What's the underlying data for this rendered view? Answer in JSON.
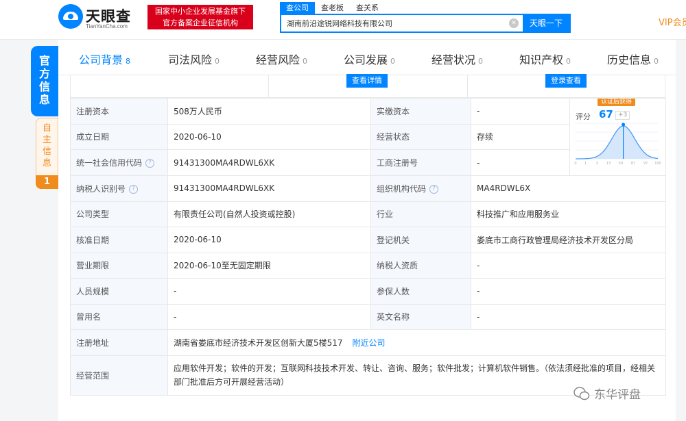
{
  "header": {
    "logo_text": "天眼查",
    "logo_sub": "TianYanCha.com",
    "badge_line1": "国家中小企业发展基金旗下",
    "badge_line2": "官方备案企业征信机构",
    "search_tabs": [
      "查公司",
      "查老板",
      "查关系"
    ],
    "search_value": "湖南前沿途锐网络科技有限公司",
    "search_button": "天眼一下",
    "vip": "VIP会员"
  },
  "side": {
    "official": [
      "官",
      "方",
      "信",
      "息"
    ],
    "self": [
      "自",
      "主",
      "信",
      "息"
    ],
    "self_count": "1"
  },
  "nav": [
    {
      "label": "公司背景",
      "count": "8"
    },
    {
      "label": "司法风险",
      "count": "0"
    },
    {
      "label": "经营风险",
      "count": "0"
    },
    {
      "label": "公司发展",
      "count": "0"
    },
    {
      "label": "经营状况",
      "count": "0"
    },
    {
      "label": "知识产权",
      "count": "0"
    },
    {
      "label": "历史信息",
      "count": "0"
    }
  ],
  "detail_buttons": {
    "view": "查看详情",
    "login": "登录查看"
  },
  "score": {
    "tag": "认证后获得",
    "label": "评分",
    "value": "67",
    "delta": "+3",
    "axis": [
      "0",
      "1",
      "3",
      "13",
      "50",
      "87",
      "97",
      "100"
    ],
    "marker_percentile": 0.58
  },
  "info": {
    "reg_capital_label": "注册资本",
    "reg_capital": "508万人民币",
    "paid_capital_label": "实缴资本",
    "paid_capital": "-",
    "est_date_label": "成立日期",
    "est_date": "2020-06-10",
    "status_label": "经营状态",
    "status": "存续",
    "credit_code_label": "统一社会信用代码",
    "credit_code": "91431300MA4RDWL6XK",
    "biz_reg_no_label": "工商注册号",
    "biz_reg_no": "-",
    "taxpayer_id_label": "纳税人识别号",
    "taxpayer_id": "91431300MA4RDWL6XK",
    "org_code_label": "组织机构代码",
    "org_code": "MA4RDWL6X",
    "company_type_label": "公司类型",
    "company_type": "有限责任公司(自然人投资或控股)",
    "industry_label": "行业",
    "industry": "科技推广和应用服务业",
    "approval_date_label": "核准日期",
    "approval_date": "2020-06-10",
    "authority_label": "登记机关",
    "authority": "娄底市工商行政管理局经济技术开发区分局",
    "term_label": "营业期限",
    "term": "2020-06-10至无固定期限",
    "taxpayer_qual_label": "纳税人资质",
    "taxpayer_qual": "-",
    "staff_label": "人员规模",
    "staff": "-",
    "insured_label": "参保人数",
    "insured": "-",
    "former_name_label": "曾用名",
    "former_name": "-",
    "english_name_label": "英文名称",
    "english_name": "-",
    "address_label": "注册地址",
    "address": "湖南省娄底市经济技术开发区创新大厦5楼517",
    "nearby": "附近公司",
    "scope_label": "经营范围",
    "scope": "应用软件开发；软件的开发；互联网科技技术开发、转让、咨询、服务；软件批发；计算机软件销售。（依法须经批准的项目，经相关部门批准后方可开展经营活动）"
  },
  "watermark": "东华评盘",
  "colors": {
    "accent": "#0084ff",
    "orange": "#f08c1e",
    "red": "#d9001b",
    "label_bg": "#f5f8fd"
  }
}
